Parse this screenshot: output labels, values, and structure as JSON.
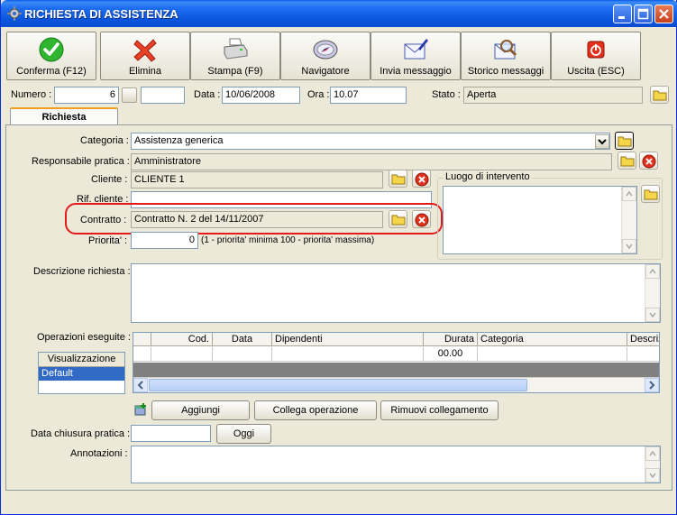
{
  "window": {
    "title": "RICHIESTA DI ASSISTENZA"
  },
  "toolbar": {
    "buttons": [
      {
        "label": "Conferma (F12)",
        "icon": "checkmark-icon"
      },
      {
        "label": "Elimina",
        "icon": "delete-x-icon"
      },
      {
        "label": "Stampa (F9)",
        "icon": "printer-icon"
      },
      {
        "label": "Navigatore",
        "icon": "compass-icon"
      },
      {
        "label": "Invia messaggio",
        "icon": "envelope-pen-icon"
      },
      {
        "label": "Storico messaggi",
        "icon": "envelope-search-icon"
      },
      {
        "label": "Uscita (ESC)",
        "icon": "exit-icon"
      }
    ]
  },
  "header": {
    "numero_label": "Numero :",
    "numero_value": "6",
    "data_label": "Data :",
    "data_value": "10/06/2008",
    "ora_label": "Ora :",
    "ora_value": "10.07",
    "stato_label": "Stato :",
    "stato_value": "Aperta"
  },
  "tabs": [
    {
      "label": "Richiesta"
    }
  ],
  "form": {
    "categoria_label": "Categoria :",
    "categoria_value": "Assistenza generica",
    "responsabile_label": "Responsabile pratica :",
    "responsabile_value": "Amministratore",
    "cliente_label": "Cliente :",
    "cliente_value": "CLIENTE 1",
    "rif_cliente_label": "Rif. cliente :",
    "rif_cliente_value": "",
    "contratto_label": "Contratto :",
    "contratto_value": "Contratto N. 2 del 14/11/2007",
    "priorita_label": "Priorita' :",
    "priorita_value": "0",
    "priorita_hint": "(1 - priorita' minima  100 - priorita' massima)",
    "luogo_legend": "Luogo di intervento",
    "descrizione_label": "Descrizione richiesta :",
    "operazioni_label": "Operazioni eseguite :",
    "data_chiusura_label": "Data chiusura pratica :",
    "data_chiusura_value": "",
    "oggi_label": "Oggi",
    "annotazioni_label": "Annotazioni :"
  },
  "grid": {
    "columns": [
      "",
      "Cod.",
      "Data",
      "Dipendenti",
      "Durata",
      "Categoria",
      "Descriz"
    ],
    "rows": [
      [
        "",
        "",
        "",
        "",
        "00.00",
        "",
        ""
      ]
    ]
  },
  "views": {
    "header": "Visualizzazione",
    "items": [
      "Default"
    ]
  },
  "actions": {
    "aggiungi": "Aggiungi",
    "collega": "Collega operazione",
    "rimuovi": "Rimuovi collegamento"
  },
  "colors": {
    "title_blue": "#0a4cd0",
    "highlight": "#e41b1b",
    "selection": "#316ac5"
  }
}
